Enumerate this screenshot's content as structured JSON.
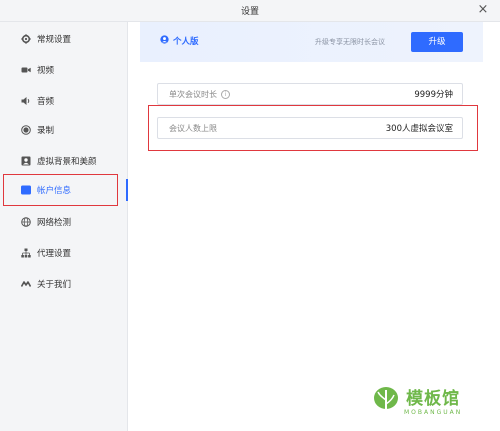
{
  "window": {
    "title": "设置",
    "close": "×"
  },
  "sidebar": {
    "items": [
      {
        "label": "常规设置",
        "icon": "gear-icon"
      },
      {
        "label": "视频",
        "icon": "video-camera-icon"
      },
      {
        "label": "音频",
        "icon": "speaker-icon"
      },
      {
        "label": "录制",
        "icon": "record-icon"
      },
      {
        "label": "虚拟背景和美颜",
        "icon": "portrait-icon"
      },
      {
        "label": "帐户信息",
        "icon": "id-card-icon",
        "active": true
      },
      {
        "label": "网络检测",
        "icon": "globe-icon"
      },
      {
        "label": "代理设置",
        "icon": "network-tree-icon"
      },
      {
        "label": "关于我们",
        "icon": "logo-m-icon"
      }
    ]
  },
  "account": {
    "plan": "个人版",
    "upgrade_hint": "升级专享无限时长会议",
    "upgrade_label": "升级",
    "rows": [
      {
        "key": "单次会议时长",
        "value": "9999分钟",
        "info": "i"
      },
      {
        "key": "会议人数上限",
        "value": "300人虚拟会议室"
      }
    ]
  },
  "watermark": {
    "cn": "模板馆",
    "en": "MOBANGUAN"
  },
  "colors": {
    "accent": "#2f6bff",
    "highlight": "#e0383e",
    "sidebar_bg": "#f4f5f7",
    "watermark": "#6fb84a"
  }
}
